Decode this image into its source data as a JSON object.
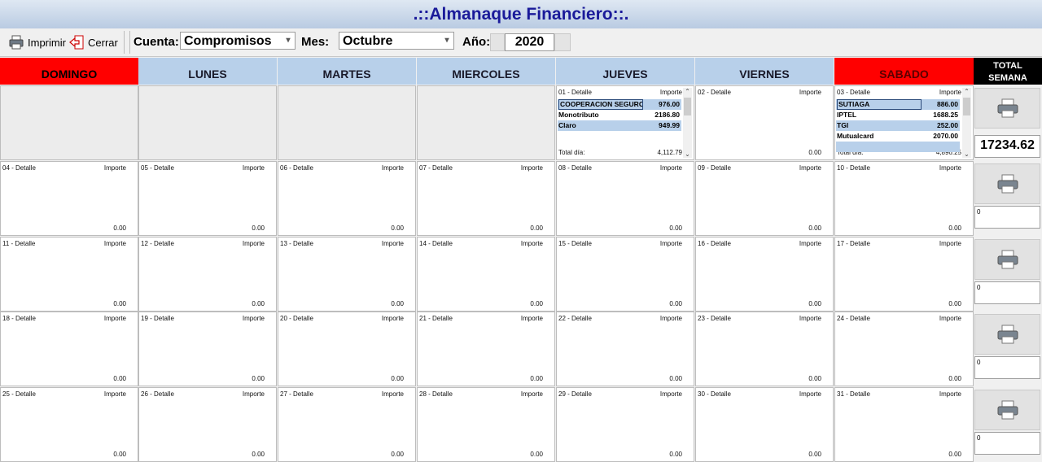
{
  "app": {
    "title": ".::Almanaque Financiero::."
  },
  "toolbar": {
    "print_label": "Imprimir",
    "close_label": "Cerrar",
    "cuenta_label": "Cuenta:",
    "cuenta_value": "Compromisos",
    "mes_label": "Mes:",
    "mes_value": "Octubre",
    "anio_label": "Año:",
    "anio_value": "2020"
  },
  "days_header": [
    "DOMINGO",
    "LUNES",
    "MARTES",
    "MIERCOLES",
    "JUEVES",
    "VIERNES",
    "SABADO"
  ],
  "total_header": {
    "line1": "TOTAL",
    "line2": "SEMANA"
  },
  "cell_labels": {
    "detalle": "Detalle",
    "importe": "Importe",
    "total_dia": "Total día:"
  },
  "weeks": [
    {
      "total": "17234.62",
      "days": [
        null,
        null,
        null,
        null,
        {
          "num": "01",
          "total": "4,112.79",
          "entries": [
            {
              "name": "COOPERACION SEGURO",
              "value": "976.00",
              "selected": true
            },
            {
              "name": "Monotributo",
              "value": "2186.80"
            },
            {
              "name": "Claro",
              "value": "949.99"
            }
          ]
        },
        {
          "num": "02",
          "total": "0.00",
          "entries": []
        },
        {
          "num": "03",
          "total": "4,896.25",
          "entries": [
            {
              "name": "SUTIAGA",
              "value": "886.00",
              "selected": true
            },
            {
              "name": "IPTEL",
              "value": "1688.25"
            },
            {
              "name": "TGI",
              "value": "252.00"
            },
            {
              "name": "Mutualcard",
              "value": "2070.00"
            }
          ]
        }
      ]
    },
    {
      "total": "0",
      "days": [
        {
          "num": "04",
          "total": "0.00",
          "entries": []
        },
        {
          "num": "05",
          "total": "0.00",
          "entries": []
        },
        {
          "num": "06",
          "total": "0.00",
          "entries": []
        },
        {
          "num": "07",
          "total": "0.00",
          "entries": []
        },
        {
          "num": "08",
          "total": "0.00",
          "entries": []
        },
        {
          "num": "09",
          "total": "0.00",
          "entries": []
        },
        {
          "num": "10",
          "total": "0.00",
          "entries": []
        }
      ]
    },
    {
      "total": "0",
      "days": [
        {
          "num": "11",
          "total": "0.00",
          "entries": []
        },
        {
          "num": "12",
          "total": "0.00",
          "entries": []
        },
        {
          "num": "13",
          "total": "0.00",
          "entries": []
        },
        {
          "num": "14",
          "total": "0.00",
          "entries": []
        },
        {
          "num": "15",
          "total": "0.00",
          "entries": []
        },
        {
          "num": "16",
          "total": "0.00",
          "entries": []
        },
        {
          "num": "17",
          "total": "0.00",
          "entries": []
        }
      ]
    },
    {
      "total": "0",
      "days": [
        {
          "num": "18",
          "total": "0.00",
          "entries": []
        },
        {
          "num": "19",
          "total": "0.00",
          "entries": []
        },
        {
          "num": "20",
          "total": "0.00",
          "entries": []
        },
        {
          "num": "21",
          "total": "0.00",
          "entries": []
        },
        {
          "num": "22",
          "total": "0.00",
          "entries": []
        },
        {
          "num": "23",
          "total": "0.00",
          "entries": []
        },
        {
          "num": "24",
          "total": "0.00",
          "entries": []
        }
      ]
    },
    {
      "total": "0",
      "days": [
        {
          "num": "25",
          "total": "0.00",
          "entries": []
        },
        {
          "num": "26",
          "total": "0.00",
          "entries": []
        },
        {
          "num": "27",
          "total": "0.00",
          "entries": []
        },
        {
          "num": "28",
          "total": "0.00",
          "entries": []
        },
        {
          "num": "29",
          "total": "0.00",
          "entries": []
        },
        {
          "num": "30",
          "total": "0.00",
          "entries": []
        },
        {
          "num": "31",
          "total": "0.00",
          "entries": []
        }
      ]
    }
  ],
  "colors": {
    "weekend_header": "#ff0000",
    "weekday_header": "#b8d0ea",
    "title_text": "#1a1a9a",
    "selected_row": "#b8d0ea"
  },
  "icons": {
    "print": "printer-icon",
    "close": "exit-arrow-icon"
  }
}
